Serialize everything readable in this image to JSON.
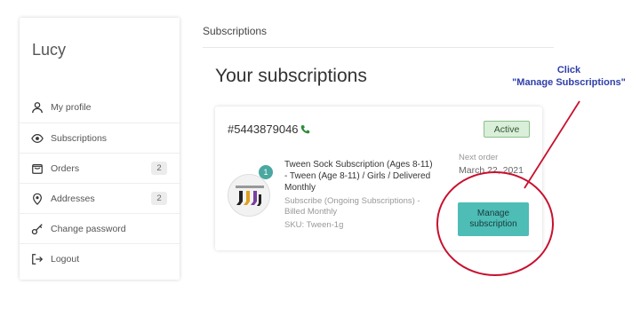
{
  "sidebar": {
    "user_name": "Lucy",
    "items": [
      {
        "label": "My profile",
        "icon": "user-icon"
      },
      {
        "label": "Subscriptions",
        "icon": "eye-icon"
      },
      {
        "label": "Orders",
        "icon": "box-icon",
        "count": "2"
      },
      {
        "label": "Addresses",
        "icon": "location-pin-icon",
        "count": "2"
      },
      {
        "label": "Change password",
        "icon": "key-icon"
      },
      {
        "label": "Logout",
        "icon": "logout-icon"
      }
    ]
  },
  "main": {
    "breadcrumb": "Subscriptions",
    "title": "Your subscriptions",
    "subscription": {
      "number": "#5443879046",
      "status": "Active",
      "quantity": "1",
      "product_name": "Tween Sock Subscription (Ages 8-11) - Tween (Age 8-11) / Girls / Delivered Monthly",
      "description": "Subscribe (Ongoing Subscriptions) - Billed Monthly",
      "sku": "SKU: Tween-1g",
      "next_order_label": "Next order",
      "next_order_date": "March 22, 2021",
      "manage_label": "Manage subscription"
    }
  },
  "annotation": {
    "line1": "Click",
    "line2": "\"Manage Subscriptions\"",
    "color": "#2e3ea8",
    "circle_color": "#c8102e"
  },
  "colors": {
    "accent": "#4dbdb6",
    "active_badge": "#d9efd9"
  }
}
